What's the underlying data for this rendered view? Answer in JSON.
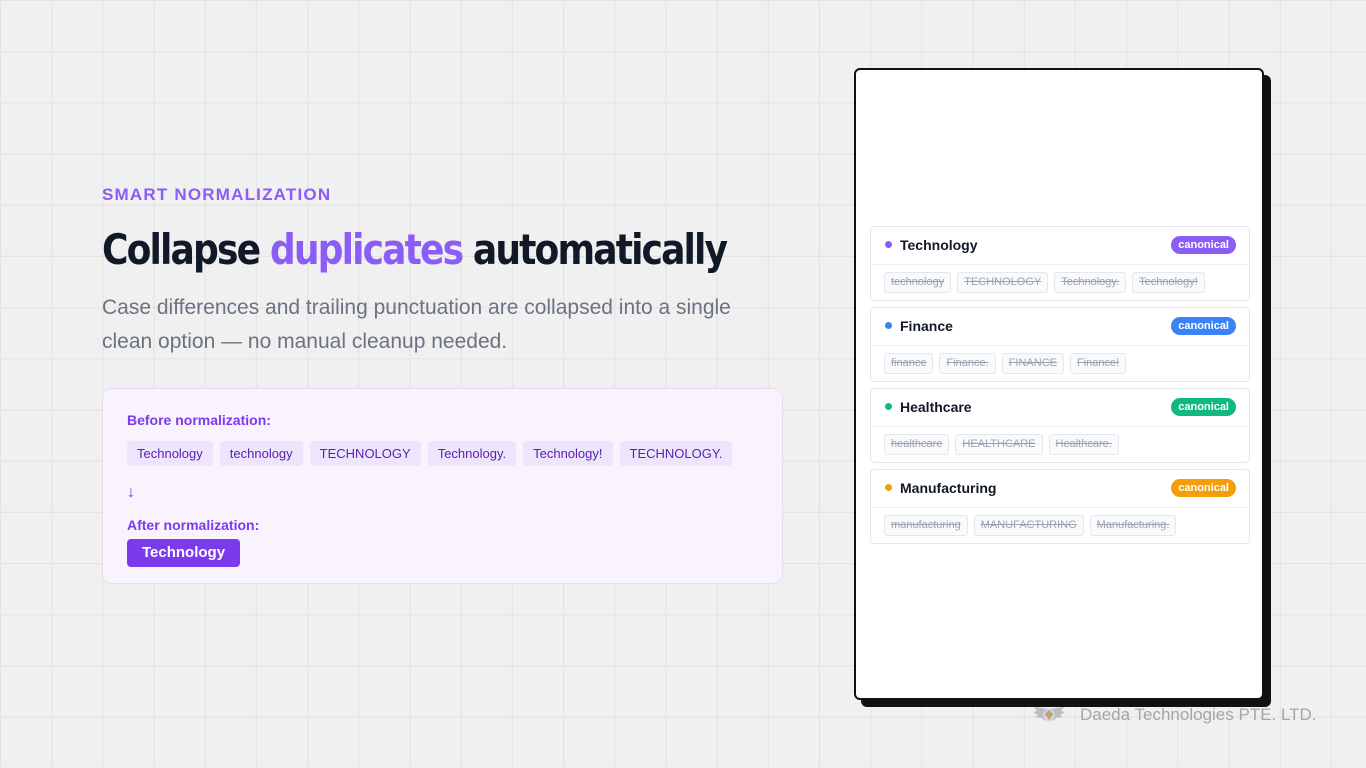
{
  "hero": {
    "eyebrow": "SMART NORMALIZATION",
    "headline_before": "Collapse ",
    "headline_accent": "duplicates",
    "headline_after": " automatically",
    "description": "Case differences and trailing punctuation are collapsed into a single clean option — no manual cleanup needed."
  },
  "demo": {
    "before_label": "Before normalization:",
    "before_values": [
      "Technology",
      "technology",
      "TECHNOLOGY",
      "Technology.",
      "Technology!",
      "TECHNOLOGY."
    ],
    "arrow_icon": "arrow-down-icon",
    "arrow_glyph": "↓",
    "after_label": "After normalization:",
    "after_value": "Technology"
  },
  "groups": [
    {
      "name": "Technology",
      "badge": "canonical",
      "color": "#8b5cf6",
      "duplicates": [
        "technology",
        "TECHNOLOGY",
        "Technology.",
        "Technology!"
      ]
    },
    {
      "name": "Finance",
      "badge": "canonical",
      "color": "#3b82f6",
      "duplicates": [
        "finance",
        "Finance.",
        "FINANCE",
        "Finance!"
      ]
    },
    {
      "name": "Healthcare",
      "badge": "canonical",
      "color": "#10b981",
      "duplicates": [
        "healthcare",
        "HEALTHCARE",
        "Healthcare."
      ]
    },
    {
      "name": "Manufacturing",
      "badge": "canonical",
      "color": "#f59e0b",
      "duplicates": [
        "manufacturing",
        "MANUFACTURING",
        "Manufacturing."
      ]
    }
  ],
  "footer": {
    "logo_icon": "winged-emblem-icon",
    "company": "Daeda Technologies PTE. LTD."
  },
  "colors": {
    "accent": "#8b5cf6",
    "accent_dark": "#7c3aed",
    "panel_border": "#111111"
  }
}
